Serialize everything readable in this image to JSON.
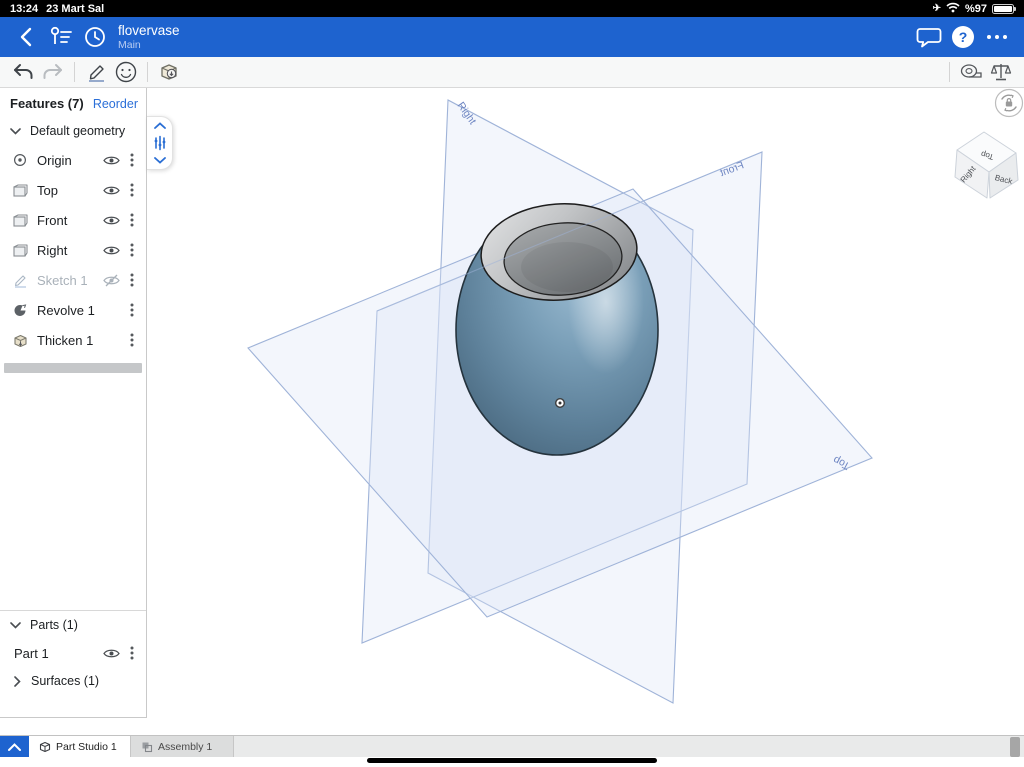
{
  "status_bar": {
    "time": "13:24",
    "date": "23 Mart Sal",
    "battery_percent": "%97"
  },
  "header": {
    "title": "flovervase",
    "subtitle": "Main"
  },
  "features_panel": {
    "title": "Features (7)",
    "reorder_label": "Reorder",
    "group_label": "Default geometry",
    "items": [
      {
        "label": "Origin",
        "icon": "origin-icon",
        "visible": true
      },
      {
        "label": "Top",
        "icon": "plane-icon",
        "visible": true
      },
      {
        "label": "Front",
        "icon": "plane-icon",
        "visible": true
      },
      {
        "label": "Right",
        "icon": "plane-icon",
        "visible": true
      },
      {
        "label": "Sketch 1",
        "icon": "sketch-icon",
        "visible": false,
        "disabled": true
      },
      {
        "label": "Revolve 1",
        "icon": "revolve-icon"
      },
      {
        "label": "Thicken 1",
        "icon": "thicken-icon"
      }
    ],
    "parts_title": "Parts (1)",
    "part_label": "Part 1",
    "surfaces_label": "Surfaces (1)"
  },
  "viewport": {
    "plane_labels": {
      "right": "Right",
      "front": "Front",
      "top": "Top"
    },
    "view_cube": {
      "top_face": "Top",
      "left_face": "Right",
      "right_face": "Back"
    },
    "colors": {
      "model_body": "#6e93ae",
      "model_rim": "#b9bcbe",
      "plane_fill": "#dce6f5",
      "plane_stroke": "#9fb3d8"
    }
  },
  "tab_bar": {
    "tabs": [
      {
        "label": "Part Studio 1",
        "active": true
      },
      {
        "label": "Assembly 1",
        "active": false
      }
    ]
  },
  "colors": {
    "accent_blue": "#1e63cf",
    "link_blue": "#2b6fd8"
  }
}
